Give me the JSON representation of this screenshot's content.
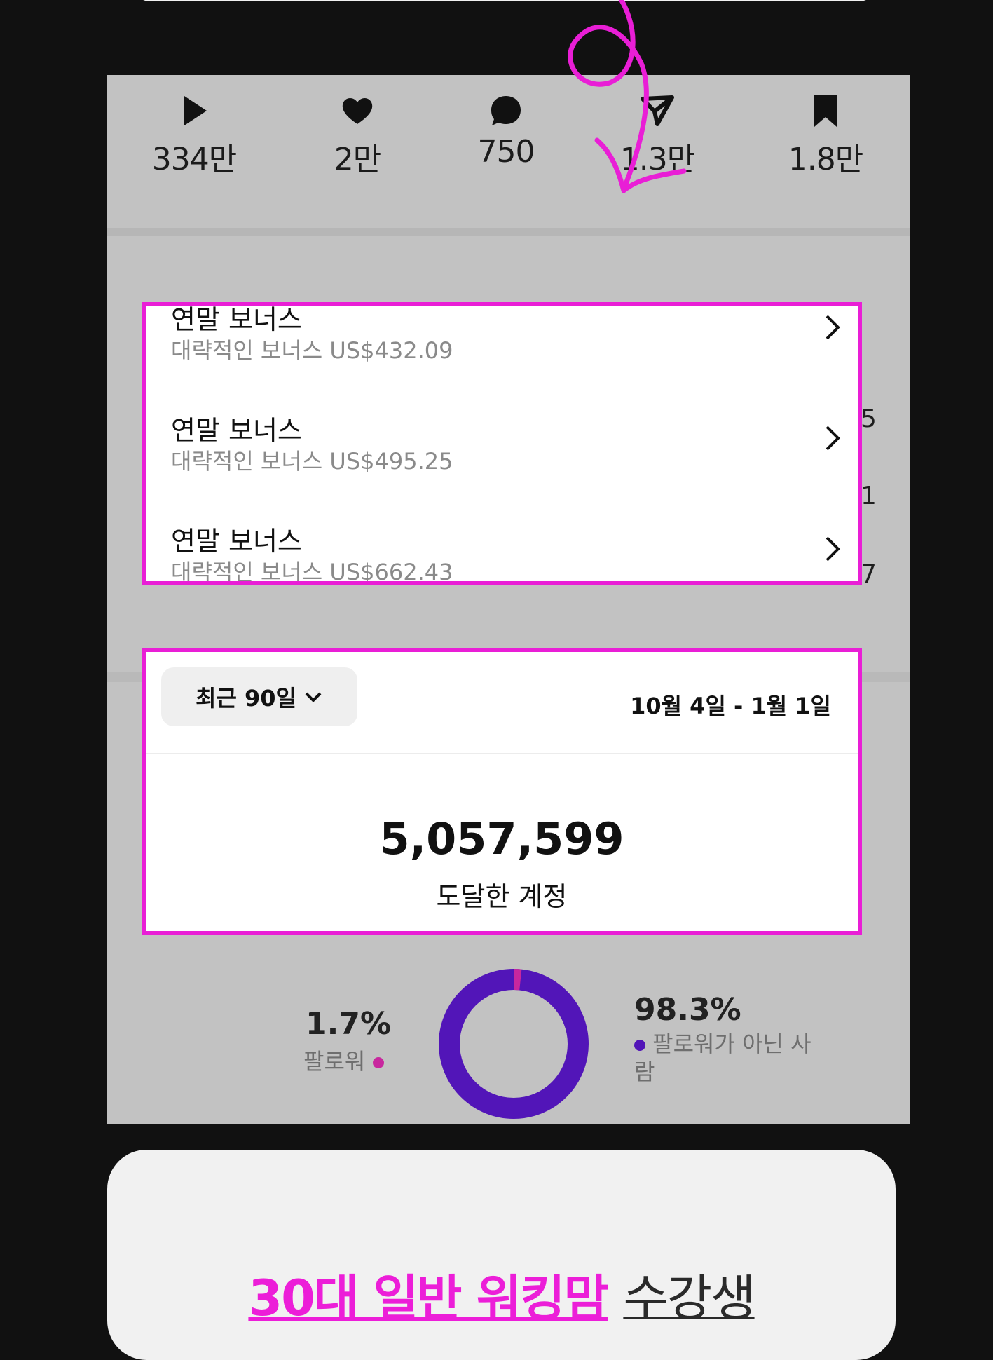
{
  "stats": [
    {
      "icon": "play-icon",
      "value": "334만"
    },
    {
      "icon": "heart-icon",
      "value": "2만"
    },
    {
      "icon": "comment-icon",
      "value": "750"
    },
    {
      "icon": "share-icon",
      "value": "1.3만"
    },
    {
      "icon": "bookmark-icon",
      "value": "1.8만"
    }
  ],
  "background_numbers": [
    "5",
    "1",
    "7"
  ],
  "bonuses": [
    {
      "title": "연말 보너스",
      "subtitle": "대략적인 보너스 US$432.09"
    },
    {
      "title": "연말 보너스",
      "subtitle": "대략적인 보너스 US$495.25"
    },
    {
      "title": "연말 보너스",
      "subtitle": "대략적인 보너스 US$662.43"
    }
  ],
  "reach": {
    "period_label": "최근 90일",
    "date_range": "10월 4일 - 1월 1일",
    "value": "5,057,599",
    "label": "도달한 계정"
  },
  "audience": {
    "followers_pct": "1.7%",
    "followers_label": "팔로워",
    "followers_fraction": 0.017,
    "nonfollowers_pct": "98.3%",
    "nonfollowers_label": "팔로워가 아닌 사람",
    "followers_color": "#c8279e",
    "nonfollowers_color": "#5215b8"
  },
  "headline": {
    "highlight": "30대 일반 워킹맘",
    "rest": "수강생"
  },
  "colors": {
    "annotation": "#e91ed6"
  }
}
